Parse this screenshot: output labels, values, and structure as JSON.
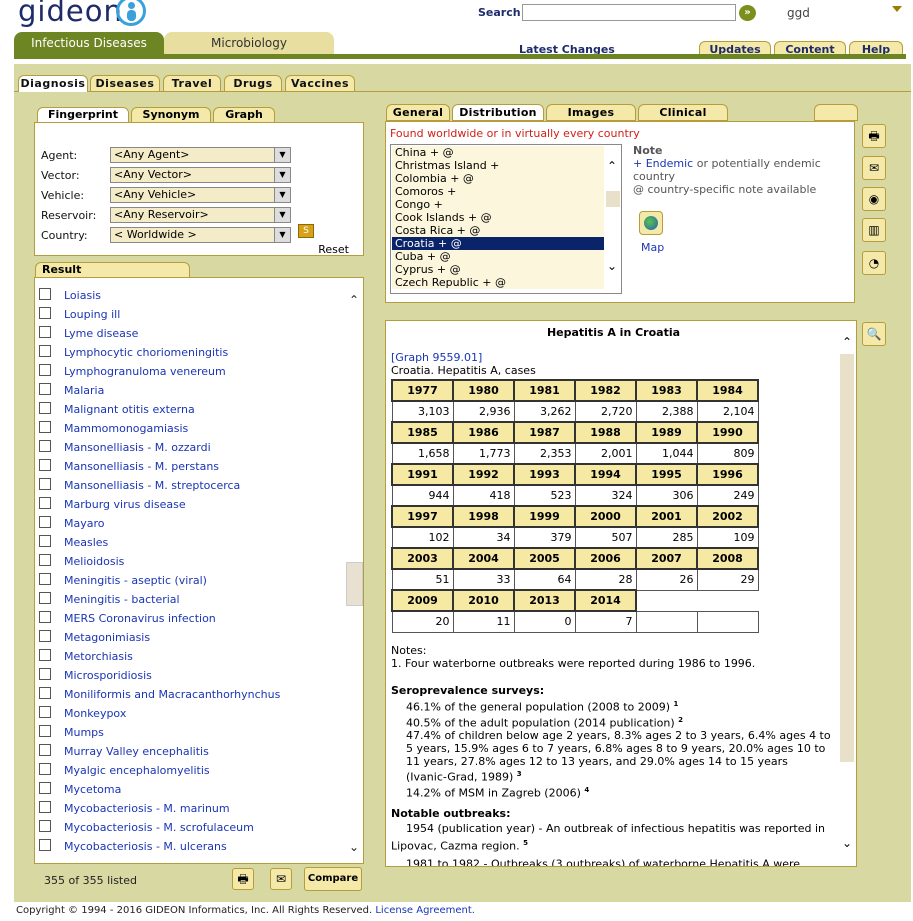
{
  "logo": {
    "text": "gideon",
    "icon": "gideon-person-icon"
  },
  "search": {
    "label": "Search",
    "value": "",
    "go_label": "»"
  },
  "user": {
    "name": "ggd"
  },
  "main_tabs": [
    {
      "label": "Infectious Diseases"
    },
    {
      "label": "Microbiology"
    }
  ],
  "latest_changes": "Latest Changes",
  "top_tabs": [
    {
      "label": "Updates"
    },
    {
      "label": "Content"
    },
    {
      "label": "Help"
    }
  ],
  "sub_tabs": [
    {
      "label": "Diagnosis"
    },
    {
      "label": "Diseases"
    },
    {
      "label": "Travel"
    },
    {
      "label": "Drugs"
    },
    {
      "label": "Vaccines"
    }
  ],
  "left_tabs": [
    {
      "label": "Fingerprint"
    },
    {
      "label": "Synonym"
    },
    {
      "label": "Graph"
    }
  ],
  "filters": [
    {
      "label": "Agent:",
      "value": "<Any Agent>"
    },
    {
      "label": "Vector:",
      "value": "<Any Vector>"
    },
    {
      "label": "Vehicle:",
      "value": "<Any Vehicle>"
    },
    {
      "label": "Reservoir:",
      "value": "<Any Reservoir>"
    },
    {
      "label": "Country:",
      "value": "< Worldwide >"
    }
  ],
  "s_button": "S",
  "reset": "Reset",
  "result_tab": "Result",
  "results": [
    "Loiasis",
    "Louping ill",
    "Lyme disease",
    "Lymphocytic choriomeningitis",
    "Lymphogranuloma venereum",
    "Malaria",
    "Malignant otitis externa",
    "Mammomonogamiasis",
    "Mansonelliasis - M. ozzardi",
    "Mansonelliasis - M. perstans",
    "Mansonelliasis - M. streptocerca",
    "Marburg virus disease",
    "Mayaro",
    "Measles",
    "Melioidosis",
    "Meningitis - aseptic (viral)",
    "Meningitis - bacterial",
    "MERS Coronavirus infection",
    "Metagonimiasis",
    "Metorchiasis",
    "Microsporidiosis",
    "Moniliformis and Macracanthorhynchus",
    "Monkeypox",
    "Mumps",
    "Murray Valley encephalitis",
    "Myalgic encephalomyelitis",
    "Mycetoma",
    "Mycobacteriosis - M. marinum",
    "Mycobacteriosis - M. scrofulaceum",
    "Mycobacteriosis - M. ulcerans"
  ],
  "listed": "355 of 355 listed",
  "compare": "Compare",
  "right_tabs": [
    {
      "label": "General"
    },
    {
      "label": "Distribution"
    },
    {
      "label": "Images"
    },
    {
      "label": "Clinical"
    }
  ],
  "found": "Found worldwide or in virtually every country",
  "countries": [
    "China + @",
    "Christmas Island +",
    "Colombia + @",
    "Comoros +",
    "Congo +",
    "Cook Islands + @",
    "Costa Rica + @",
    "Croatia + @",
    "Cuba + @",
    "Cyprus + @",
    "Czech Republic + @"
  ],
  "note": {
    "title": "Note",
    "line1a": "+ Endemic",
    "line1b": " or potentially endemic",
    "line2": "country",
    "line3": "@ country-specific note available"
  },
  "map_label": "Map",
  "detail": {
    "title": "Hepatitis A in Croatia",
    "graph_ref": "[Graph 9559.01]",
    "subtitle": "Croatia. Hepatitis A, cases",
    "rows": [
      {
        "years": [
          "1977",
          "1980",
          "1981",
          "1982",
          "1983",
          "1984"
        ],
        "values": [
          "3,103",
          "2,936",
          "3,262",
          "2,720",
          "2,388",
          "2,104"
        ]
      },
      {
        "years": [
          "1985",
          "1986",
          "1987",
          "1988",
          "1989",
          "1990"
        ],
        "values": [
          "1,658",
          "1,773",
          "2,353",
          "2,001",
          "1,044",
          "809"
        ]
      },
      {
        "years": [
          "1991",
          "1992",
          "1993",
          "1994",
          "1995",
          "1996"
        ],
        "values": [
          "944",
          "418",
          "523",
          "324",
          "306",
          "249"
        ]
      },
      {
        "years": [
          "1997",
          "1998",
          "1999",
          "2000",
          "2001",
          "2002"
        ],
        "values": [
          "102",
          "34",
          "379",
          "507",
          "285",
          "109"
        ]
      },
      {
        "years": [
          "2003",
          "2004",
          "2005",
          "2006",
          "2007",
          "2008"
        ],
        "values": [
          "51",
          "33",
          "64",
          "28",
          "26",
          "29"
        ]
      },
      {
        "years": [
          "2009",
          "2010",
          "2013",
          "2014"
        ],
        "values": [
          "20",
          "11",
          "0",
          "7"
        ]
      }
    ],
    "notes_title": "Notes:",
    "notes_1": "1. Four waterborne outbreaks were reported during 1986 to 1996.",
    "sero_title": "Seroprevalence surveys:",
    "sero": [
      {
        "text": "46.1% of the general population (2008 to 2009)",
        "sup": "1"
      },
      {
        "text": "40.5% of the adult population (2014 publication)",
        "sup": "2"
      },
      {
        "text": "47.4% of children below age 2 years, 8.3% ages 2 to 3 years, 6.4% ages 4 to 5 years, 15.9% ages 6 to 7 years, 6.8% ages 8 to 9 years, 20.0% ages 10 to 11 years, 27.8% ages 12 to 13 years, and 29.0% ages 14 to 15 years (Ivanic-Grad, 1989)",
        "sup": "3"
      },
      {
        "text": "14.2% of MSM in Zagreb (2006)",
        "sup": "4"
      }
    ],
    "outbreaks_title": "Notable outbreaks:",
    "outbreaks": [
      {
        "text": "1954 (publication year) - An outbreak of infectious hepatitis was reported in Lipovac, Cazma region.",
        "sup": "5"
      },
      {
        "text": "1981 to 1982 - Outbreaks (3 outbreaks) of waterborne Hepatitis A were",
        "sup": ""
      }
    ]
  },
  "footer": {
    "copyright": "Copyright © 1994 - 2016 GIDEON Informatics, Inc. All Rights Reserved.",
    "license": "License Agreement."
  }
}
